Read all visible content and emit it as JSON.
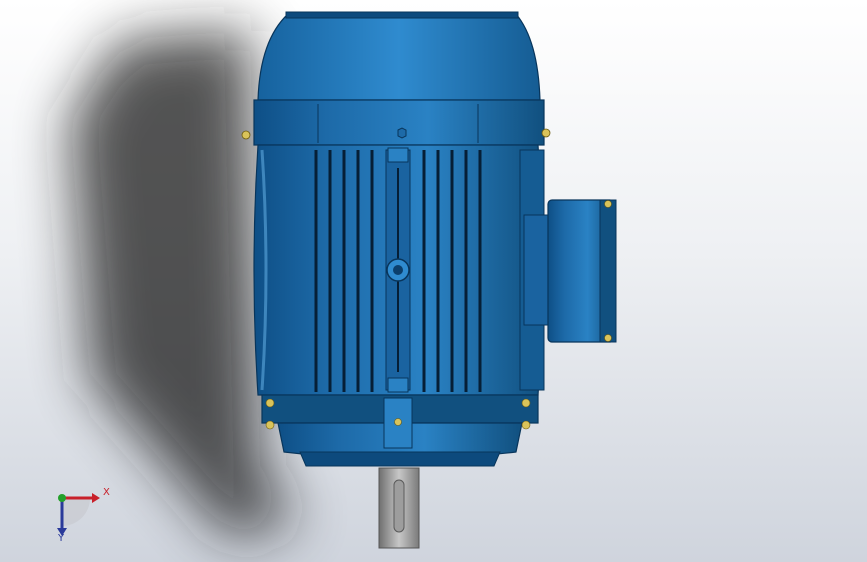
{
  "viewport": {
    "background_top": "#ffffff",
    "background_bottom": "#cfd4dd"
  },
  "model": {
    "body_color": "#1d6aa8",
    "body_dark": "#0b3f6c",
    "highlight": "#5ea9dd",
    "shaft_color": "#8c8c8c",
    "bolt_color": "#d9c35a"
  },
  "triad": {
    "x_label": "X",
    "y_label": "Y",
    "x_color": "#c8202a",
    "y_color": "#2a3a9a",
    "origin_color": "#23a02a"
  }
}
